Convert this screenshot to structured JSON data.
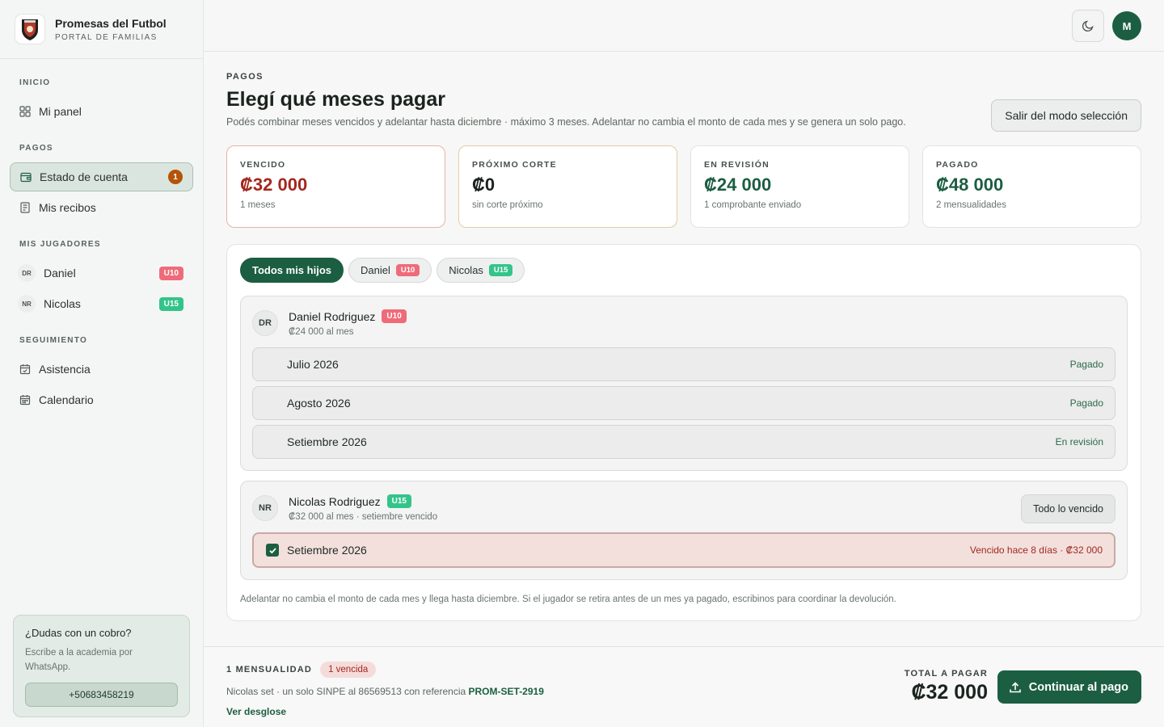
{
  "brand": {
    "name": "Promesas del Futbol",
    "subtitle": "PORTAL DE FAMILIAS"
  },
  "nav": {
    "section_inicio": "INICIO",
    "mi_panel": "Mi panel",
    "section_pagos": "PAGOS",
    "estado_cuenta": "Estado de cuenta",
    "estado_cuenta_badge": "1",
    "mis_recibos": "Mis recibos",
    "section_jugadores": "MIS JUGADORES",
    "players": [
      {
        "initials": "DR",
        "name": "Daniel",
        "category": "U10"
      },
      {
        "initials": "NR",
        "name": "Nicolas",
        "category": "U15"
      }
    ],
    "section_seguimiento": "SEGUIMIENTO",
    "asistencia": "Asistencia",
    "calendario": "Calendario"
  },
  "help": {
    "title": "¿Dudas con un cobro?",
    "text": "Escribe a la academia por WhatsApp.",
    "phone": "+50683458219"
  },
  "topbar": {
    "user_initial": "M",
    "theme_icon": "moon-icon"
  },
  "page": {
    "eyebrow": "PAGOS",
    "title": "Elegí qué meses pagar",
    "subtitle": "Podés combinar meses vencidos y adelantar hasta diciembre · máximo 3 meses. Adelantar no cambia el monto de cada mes y se genera un solo pago.",
    "exit_button": "Salir del modo selección"
  },
  "stats": [
    {
      "label": "VENCIDO",
      "value": "₡32 000",
      "sub": "1 meses",
      "color": "#a3281f"
    },
    {
      "label": "PRÓXIMO CORTE",
      "value": "₡0",
      "sub": "sin corte próximo",
      "color": "#1b231e"
    },
    {
      "label": "EN REVISIÓN",
      "value": "₡24 000",
      "sub": "1 comprobante enviado",
      "color": "#1c5e42"
    },
    {
      "label": "PAGADO",
      "value": "₡48 000",
      "sub": "2 mensualidades",
      "color": "#1c5e42"
    }
  ],
  "filters": {
    "all": "Todos mis hijos",
    "daniel": "Daniel",
    "daniel_tag": "U10",
    "nicolas": "Nicolas",
    "nicolas_tag": "U15"
  },
  "players": [
    {
      "initials": "DR",
      "name": "Daniel Rodriguez",
      "category": "U10",
      "sub": "₡24 000 al mes",
      "months": [
        {
          "label": "Julio 2026",
          "status": "Pagado"
        },
        {
          "label": "Agosto 2026",
          "status": "Pagado"
        },
        {
          "label": "Setiembre 2026",
          "status": "En revisión"
        }
      ]
    },
    {
      "initials": "NR",
      "name": "Nicolas Rodriguez",
      "category": "U15",
      "sub": "₡32 000 al mes · setiembre vencido",
      "action": "Todo lo vencido",
      "months": [
        {
          "label": "Setiembre 2026",
          "status": "Vencido hace 8 días · ₡32 000",
          "checked": true
        }
      ]
    }
  ],
  "footnote": "Adelantar no cambia el monto de cada mes y llega hasta diciembre. Si el jugador se retira antes de un mes ya pagado, escribinos para coordinar la devolución.",
  "summary": {
    "count_label": "1 MENSUALIDAD",
    "overdue_pill": "1 vencida",
    "ref_text": "Nicolas set · un solo SINPE al 86569513 con referencia ",
    "ref_code": "PROM-SET-2919",
    "breakdown_link": "Ver desglose",
    "total_label": "TOTAL A PAGAR",
    "total_value": "₡32 000",
    "pay_button": "Continuar al pago"
  }
}
